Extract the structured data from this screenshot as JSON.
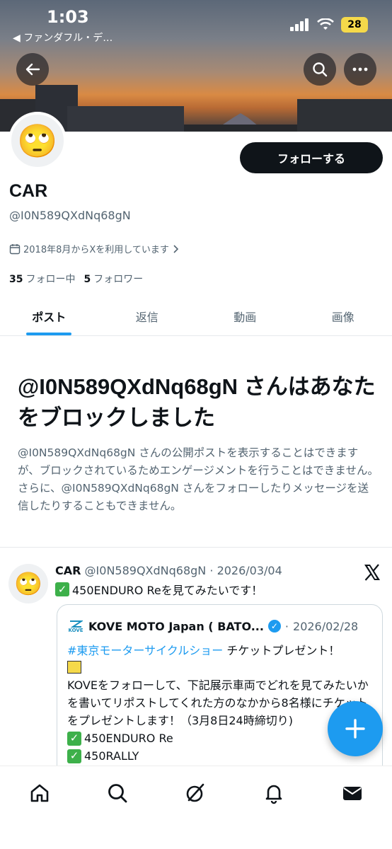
{
  "status_bar": {
    "time": "1:03",
    "back_app": "◀ ファンダフル・デ…",
    "battery": "28"
  },
  "profile": {
    "avatar_emoji": "🙄",
    "name": "CAR",
    "handle": "@I0N589QXdNq68gN",
    "joined": "2018年8月からXを利用しています",
    "following_count": "35",
    "following_label": "フォロー中",
    "followers_count": "5",
    "followers_label": "フォロワー",
    "follow_button": "フォローする"
  },
  "tabs": [
    {
      "label": "ポスト",
      "active": true
    },
    {
      "label": "返信",
      "active": false
    },
    {
      "label": "動画",
      "active": false
    },
    {
      "label": "画像",
      "active": false
    }
  ],
  "blocked": {
    "title": "@I0N589QXdNq68gN さんはあなたをブロックしました",
    "description": "@I0N589QXdNq68gN さんの公開ポストを表示することはできますが、ブロックされているためエンゲージメントを行うことはできません。さらに、@I0N589QXdNq68gN さんをフォローしたりメッセージを送信したりすることもできません。"
  },
  "post": {
    "author_name": "CAR",
    "author_handle": "@I0N589QXdNq68gN",
    "separator": "·",
    "date": "2026/03/04",
    "text": "450ENDURO Reを見てみたいです！",
    "quote": {
      "logo_text": "KOVE",
      "author_name": "KOVE MOTO Japan ( BATO...",
      "date": "2026/02/28",
      "hashtag": "#東京モーターサイクルショー",
      "line1_rest": " チケットプレゼント！",
      "body": "KOVEをフォローして、下記展示車両でどれを見てみたいかを書いてリポストしてくれた方のなかから8名様にチケットをプレゼントします！（3月8日24時締切り)",
      "item1": "450ENDURO Re",
      "item2": "450RALLY"
    }
  },
  "colors": {
    "accent": "#1d9bf0",
    "text": "#0f1419",
    "muted": "#536471"
  },
  "icons": {
    "back": "arrow-left-icon",
    "search": "search-icon",
    "more": "more-icon",
    "calendar": "calendar-icon",
    "x_logo": "x-logo-icon",
    "compose": "plus-icon",
    "nav": [
      "home-icon",
      "search-icon",
      "grok-icon",
      "bell-icon",
      "mail-icon"
    ]
  }
}
